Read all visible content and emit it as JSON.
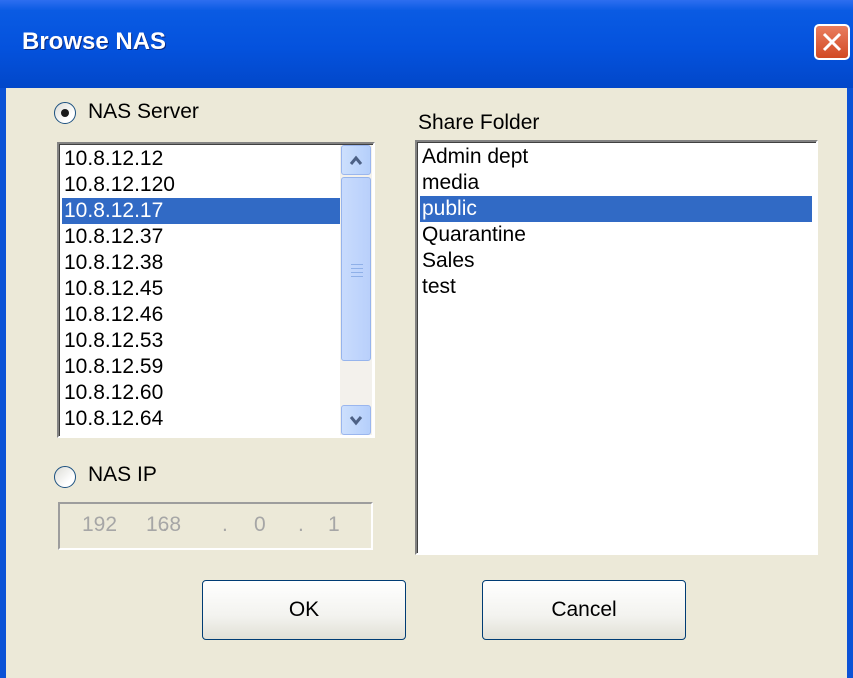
{
  "window": {
    "title": "Browse NAS"
  },
  "nas_server": {
    "label": "NAS Server",
    "selected": true
  },
  "server_list": {
    "items": [
      "10.8.12.12",
      "10.8.12.120",
      "10.8.12.17",
      "10.8.12.37",
      "10.8.12.38",
      "10.8.12.45",
      "10.8.12.46",
      "10.8.12.53",
      "10.8.12.59",
      "10.8.12.60",
      "10.8.12.64"
    ],
    "selected": "10.8.12.17"
  },
  "nas_ip": {
    "label": "NAS IP",
    "selected": false,
    "octets": [
      "192",
      "168",
      "0",
      "1"
    ]
  },
  "share_folder": {
    "label": "Share Folder",
    "items": [
      "Admin dept",
      "media",
      "public",
      "Quarantine",
      "Sales",
      "test"
    ],
    "selected": "public"
  },
  "buttons": {
    "ok": "OK",
    "cancel": "Cancel"
  },
  "colors": {
    "title_bar": "#0452dd",
    "selection": "#316ac5",
    "dialog_bg": "#ece9d8"
  }
}
